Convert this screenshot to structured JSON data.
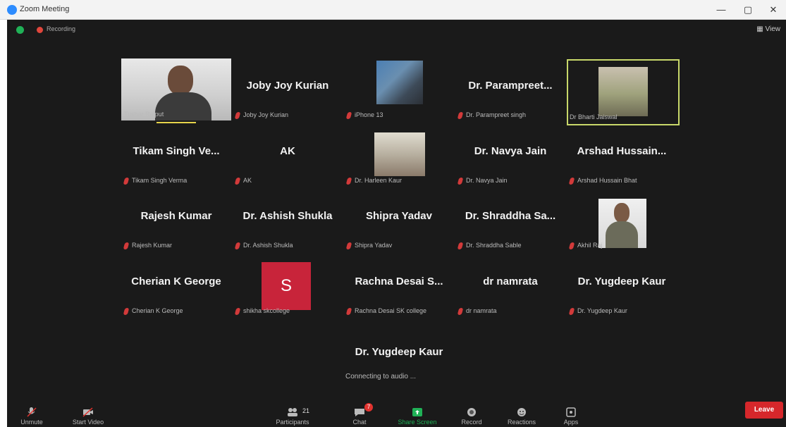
{
  "window": {
    "title": "Zoom Meeting",
    "minimize": "—",
    "maximize": "▢",
    "close": "✕"
  },
  "topbar": {
    "recording_label": "Recording",
    "view_label": "View"
  },
  "tiles": [
    {
      "big": "",
      "small": "Tushar Rajput"
    },
    {
      "big": "Joby Joy Kurian",
      "small": "Joby Joy Kurian"
    },
    {
      "big": "",
      "small": "iPhone 13"
    },
    {
      "big": "Dr.  Parampreet...",
      "small": "Dr. Parampreet singh"
    },
    {
      "big": "",
      "small": "Dr Bharti Jaiswal"
    },
    {
      "big": "Tikam Singh Ve...",
      "small": "Tikam Singh Verma"
    },
    {
      "big": "AK",
      "small": "AK"
    },
    {
      "big": "",
      "small": "Dr. Harleen Kaur"
    },
    {
      "big": "Dr. Navya Jain",
      "small": "Dr. Navya Jain"
    },
    {
      "big": "Arshad  Hussain...",
      "small": "Arshad Hussain Bhat"
    },
    {
      "big": "Rajesh Kumar",
      "small": "Rajesh Kumar"
    },
    {
      "big": "Dr. Ashish Shukla",
      "small": "Dr. Ashish Shukla"
    },
    {
      "big": "Shipra Yadav",
      "small": "Shipra Yadav"
    },
    {
      "big": "Dr. Shraddha Sa...",
      "small": "Dr. Shraddha Sable"
    },
    {
      "big": "",
      "small": "Akhil Raj"
    },
    {
      "big": "Cherian K George",
      "small": "Cherian K George"
    },
    {
      "big": "",
      "small": "shikha skcollege",
      "avatar": "S"
    },
    {
      "big": "Rachna Desai S...",
      "small": "Rachna Desai SK college"
    },
    {
      "big": "dr namrata",
      "small": "dr namrata"
    },
    {
      "big": "Dr. Yugdeep Kaur",
      "small": "Dr. Yugdeep Kaur"
    },
    {
      "big": "Dr. Yugdeep Kaur",
      "small": ""
    }
  ],
  "connecting_text": "Connecting to audio ...",
  "toolbar": {
    "unmute": "Unmute",
    "start_video": "Start Video",
    "participants": "Participants",
    "participants_count": "21",
    "chat": "Chat",
    "chat_badge": "7",
    "share_screen": "Share Screen",
    "record": "Record",
    "reactions": "Reactions",
    "apps": "Apps",
    "leave": "Leave"
  },
  "colors": {
    "accent_green": "#20b157",
    "leave_red": "#d6272b",
    "active_speaker": "#c8d86a",
    "avatar_red": "#c8243a"
  }
}
